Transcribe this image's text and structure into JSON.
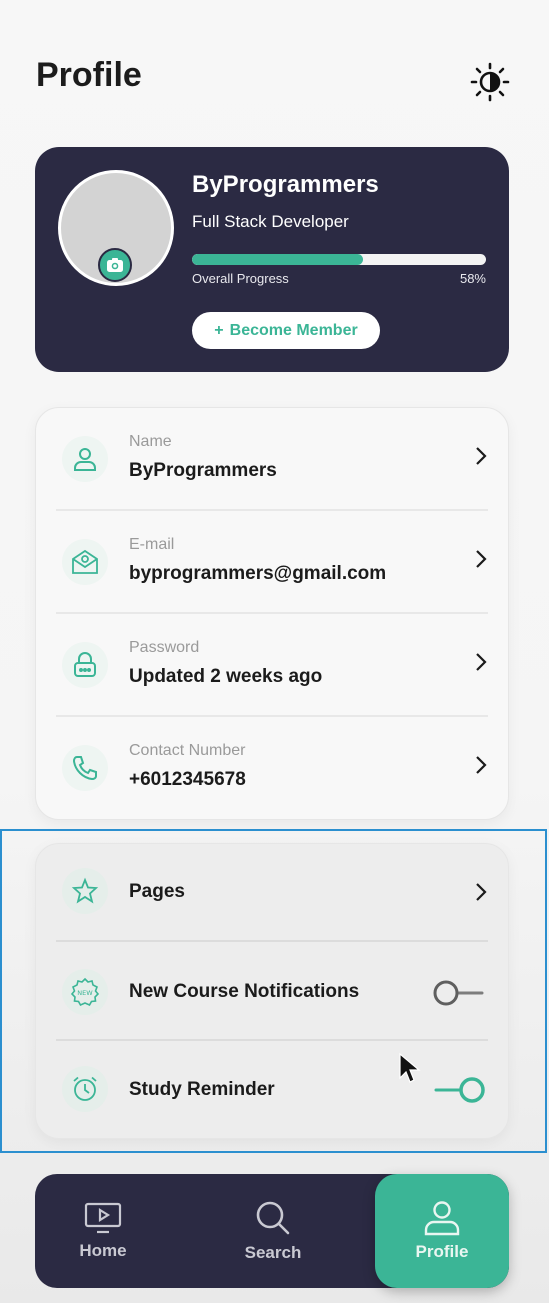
{
  "header": {
    "title": "Profile",
    "theme_icon": "brightness-icon"
  },
  "profile": {
    "name": "ByProgrammers",
    "role": "Full Stack Developer",
    "progress_label": "Overall Progress",
    "progress_value": "58%",
    "progress_fraction": 0.58,
    "member_button": "Become Member",
    "member_button_icon": "+"
  },
  "info": [
    {
      "label": "Name",
      "value": "ByProgrammers",
      "icon": "user-icon"
    },
    {
      "label": "E-mail",
      "value": "byprogrammers@gmail.com",
      "icon": "email-icon"
    },
    {
      "label": "Password",
      "value": "Updated 2 weeks ago",
      "icon": "lock-icon"
    },
    {
      "label": "Contact Number",
      "value": "+6012345678",
      "icon": "phone-icon"
    }
  ],
  "settings": [
    {
      "title": "Pages",
      "control": "chevron",
      "icon": "star-icon"
    },
    {
      "title": "New Course Notifications",
      "control": "toggle",
      "on": false,
      "icon": "new-badge-icon"
    },
    {
      "title": "Study Reminder",
      "control": "toggle",
      "on": true,
      "icon": "alarm-icon"
    }
  ],
  "nav": [
    {
      "label": "Home",
      "icon": "tv-play-icon",
      "active": false
    },
    {
      "label": "Search",
      "icon": "search-icon",
      "active": false
    },
    {
      "label": "Profile",
      "icon": "user-icon",
      "active": true
    }
  ],
  "colors": {
    "primary_dark": "#2b2a43",
    "accent": "#3bb596",
    "selection_outline": "#2b8fcf"
  }
}
